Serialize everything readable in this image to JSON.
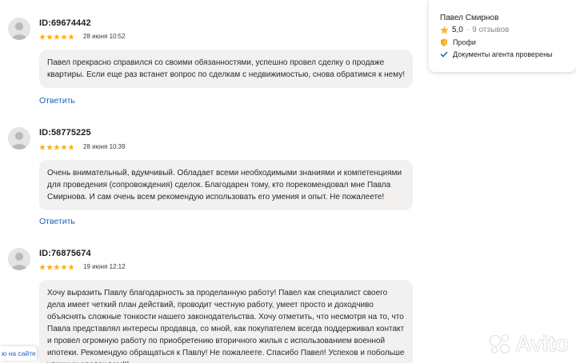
{
  "reviews": [
    {
      "id": "ID:69674442",
      "date": "28 июня 10:52",
      "rating": 5,
      "text": "Павел прекрасно справился со своими обязанностями, успешно провел сделку о продаже квартиры. Если еще раз встанет вопрос по сделкам с недвижимостью, снова обратимся к нему!",
      "reply_label": "Ответить"
    },
    {
      "id": "ID:58775225",
      "date": "28 июня 10:39",
      "rating": 5,
      "text": "Очень внимательный, вдумчивый. Обладает всеми необходимыми знаниями и компетенциями для проведения (сопровождения) сделок. Благодарен тому, кто порекомендовал мне Павла Смирнова. И сам очень всем рекомендую использовать его умения и опыт. Не пожалеете!",
      "reply_label": "Ответить"
    },
    {
      "id": "ID:76875674",
      "date": "19 июня 12:12",
      "rating": 5,
      "text": "Хочу выразить Павлу благодарность за проделанную работу! Павел как специалист своего дела имеет четкий план действий, проводит честную работу, умеет просто и доходчиво объяснять сложные тонкости нашего законодательства. Хочу отметить, что несмотря на то, что Павла представлял интересы продавца, со мной, как покупателем всегда поддерживал контакт и провел огромную работу по приобретению вторичного жилья с использованием военной ипотеки. Рекомендую обращаться к Павлу! Не пожалеете. Спасибо Павел! Успехов и побольше удачных сделок вам!!!"
    }
  ],
  "agent": {
    "name": "Павел Смирнов",
    "rating": "5,0",
    "separator": "·",
    "reviews_count": "9 отзывов",
    "badges": [
      {
        "icon": "shield-icon",
        "label": "Профи"
      },
      {
        "icon": "checkmark-icon",
        "label": "Документы агента проверены"
      }
    ]
  },
  "left_edge_link": "ю на сайте",
  "watermark": "Avito",
  "colors": {
    "star": "#ffb021",
    "link": "#1565c0",
    "bubble": "#f2f1f0",
    "shield": "#f5a623",
    "check": "#1565c0"
  }
}
